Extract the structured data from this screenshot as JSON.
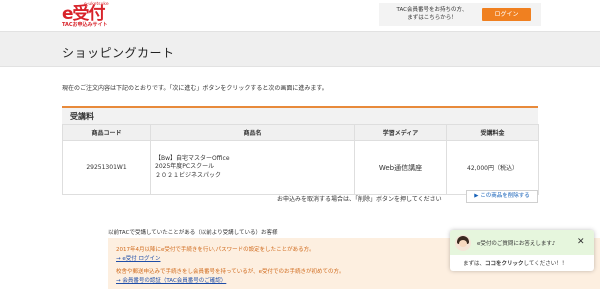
{
  "header": {
    "logo_main": "e受付",
    "logo_tiny": "e-uketsuke",
    "logo_sub": "TACお申込みサイト",
    "member_prompt_line1": "TAC会員番号をお持ちの方、",
    "member_prompt_line2": "まずはこちらから！",
    "login_label": "ログイン"
  },
  "page": {
    "title": "ショッピングカート",
    "intro": "現在のご注文内容は下記のとおりです。「次に進む」ボタンをクリックすると次の画面に進みます。"
  },
  "section": {
    "title": "受講料"
  },
  "table": {
    "headers": [
      "商品コード",
      "商品名",
      "学習メディア",
      "受講料金"
    ],
    "rows": [
      {
        "code": "29251301W1",
        "name_line1": "【Bw】自宅マスターOffice",
        "name_line2": "2025年度PCスクール",
        "name_line3": "２０２１ビジネスパック",
        "media": "Web通信講座",
        "price": "42,000円（税込）"
      }
    ]
  },
  "cancel": {
    "note": "お申込みを取消する場合は、「削除」ボタンを押してください",
    "delete_label": "▶ この商品を削除する"
  },
  "info": {
    "prev_member": "以前TACで受講していたことがある（以前より受講している）お客様",
    "line1": "2017年4月以降にe受付で手続きを行い,パスワードの設定をしたことがある方。",
    "link1": "→ e受付 ログイン",
    "line2": "校舎や郵送申込みで手続きをし会員番号を持っているが、e受付でのお手続きが初めての方。",
    "link2": "→ 会員番号の認証（TAC会員番号のご確認）"
  },
  "chat": {
    "message": "e受付のご質問にお答えします♪",
    "prompt_prefix": "まずは、",
    "prompt_bold": "ココをクリック",
    "prompt_suffix": "してください！！"
  },
  "colors": {
    "brand_red": "#d8232a",
    "accent_orange": "#f08020",
    "link_blue": "#1f4ea8",
    "info_bg": "#fdefe0",
    "chat_bg": "#e6f6dd"
  }
}
